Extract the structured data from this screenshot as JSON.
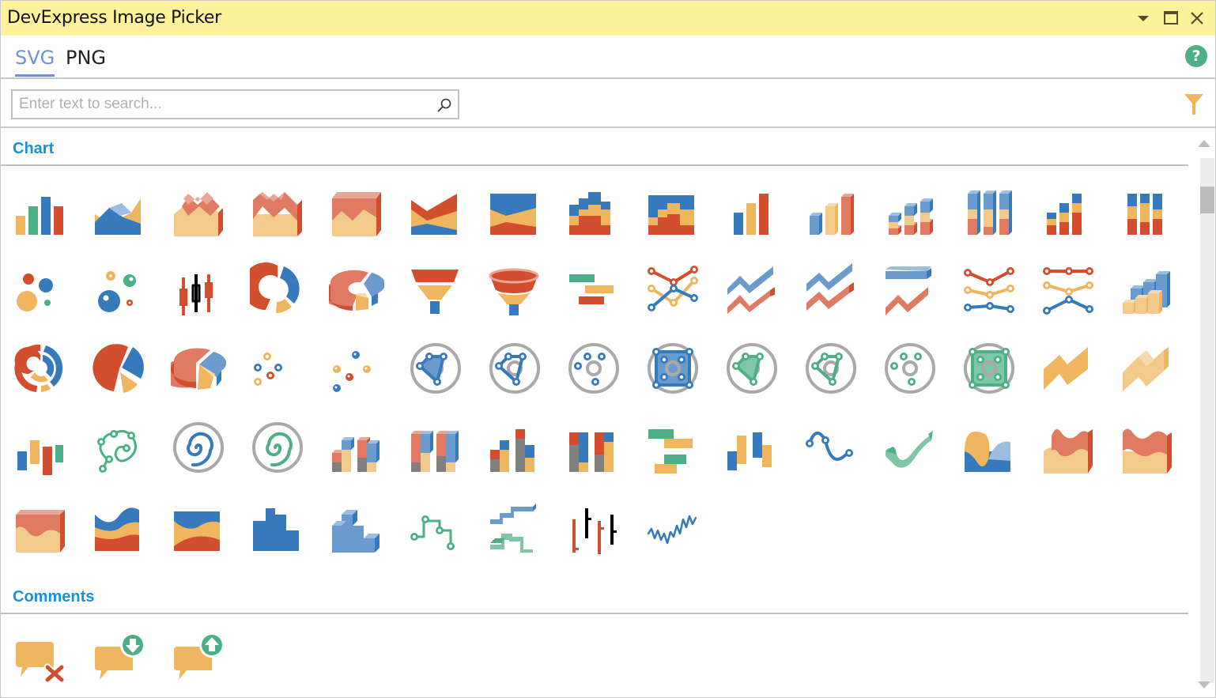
{
  "window": {
    "title": "DevExpress Image Picker",
    "controls": [
      "dropdown-arrow",
      "maximize",
      "close"
    ]
  },
  "tabs": [
    {
      "label": "SVG",
      "active": true
    },
    {
      "label": "PNG",
      "active": false
    }
  ],
  "help": {
    "label": "?",
    "color": "#4daf86"
  },
  "search": {
    "value": "",
    "placeholder": "Enter text to search..."
  },
  "filter": {
    "color": "#efb55f"
  },
  "colors": {
    "blue": "#377abb",
    "lightblue": "#6a9bcc",
    "paleblue": "#9bbde0",
    "red": "#d24e2e",
    "salmon": "#e07a62",
    "pink": "#e9a697",
    "orange": "#efb55f",
    "peach": "#f2ca8c",
    "lightpeach": "#f6dbae",
    "green": "#4daf86",
    "lightgreen": "#7ec6a5",
    "gray": "#808080",
    "ringgray": "#a9a9a9",
    "accent_tab": "#6f8fdb",
    "group_header": "#1592d8"
  },
  "groups": [
    {
      "name": "Chart",
      "icons": [
        "bar",
        "area",
        "area3d-stacked",
        "area3d",
        "area3d-full",
        "stacked-area-full-red",
        "stacked-area-full-blue",
        "step-stacked",
        "step-stacked-full",
        "bar-simple",
        "bar3d",
        "bar3d-stacked",
        "bar3d-full-stacked",
        "bar-stacked",
        "bar-full-stacked",
        "bubble",
        "bubble3d",
        "candlestick",
        "doughnut",
        "doughnut3d",
        "funnel",
        "funnel3d",
        "gantt",
        "line-markers",
        "line3d",
        "line3d-dual",
        "line3d-flat",
        "line-markers-stacked",
        "line-markers-full",
        "bar3d-manhattan",
        "nested-doughnut",
        "pie",
        "pie3d",
        "point",
        "point3d",
        "polar-area",
        "polar-line",
        "polar-point",
        "polar-range",
        "radar-area",
        "radar-line",
        "radar-point",
        "radar-range",
        "range-area",
        "range-area3d",
        "range-bar",
        "scatter-polar-line",
        "spiral-blue",
        "spiral-green",
        "side-by-side-stacked-bar3d",
        "side-by-side-full-stacked-bar3d",
        "side-by-side-stacked-bar",
        "side-by-side-full-stacked-bar",
        "side-by-side-gantt",
        "side-by-side-range-bar",
        "spline",
        "spline3d",
        "spline-area",
        "spline-area3d-stacked",
        "spline-area3d",
        "spline-area3d-full",
        "stacked-spline-area",
        "full-stacked-spline-area",
        "step-area",
        "step-area3d",
        "step-line",
        "step-line3d",
        "stock",
        "swift-plot"
      ]
    },
    {
      "name": "Comments",
      "icons": [
        "comment-delete",
        "comment-next",
        "comment-previous"
      ]
    }
  ]
}
